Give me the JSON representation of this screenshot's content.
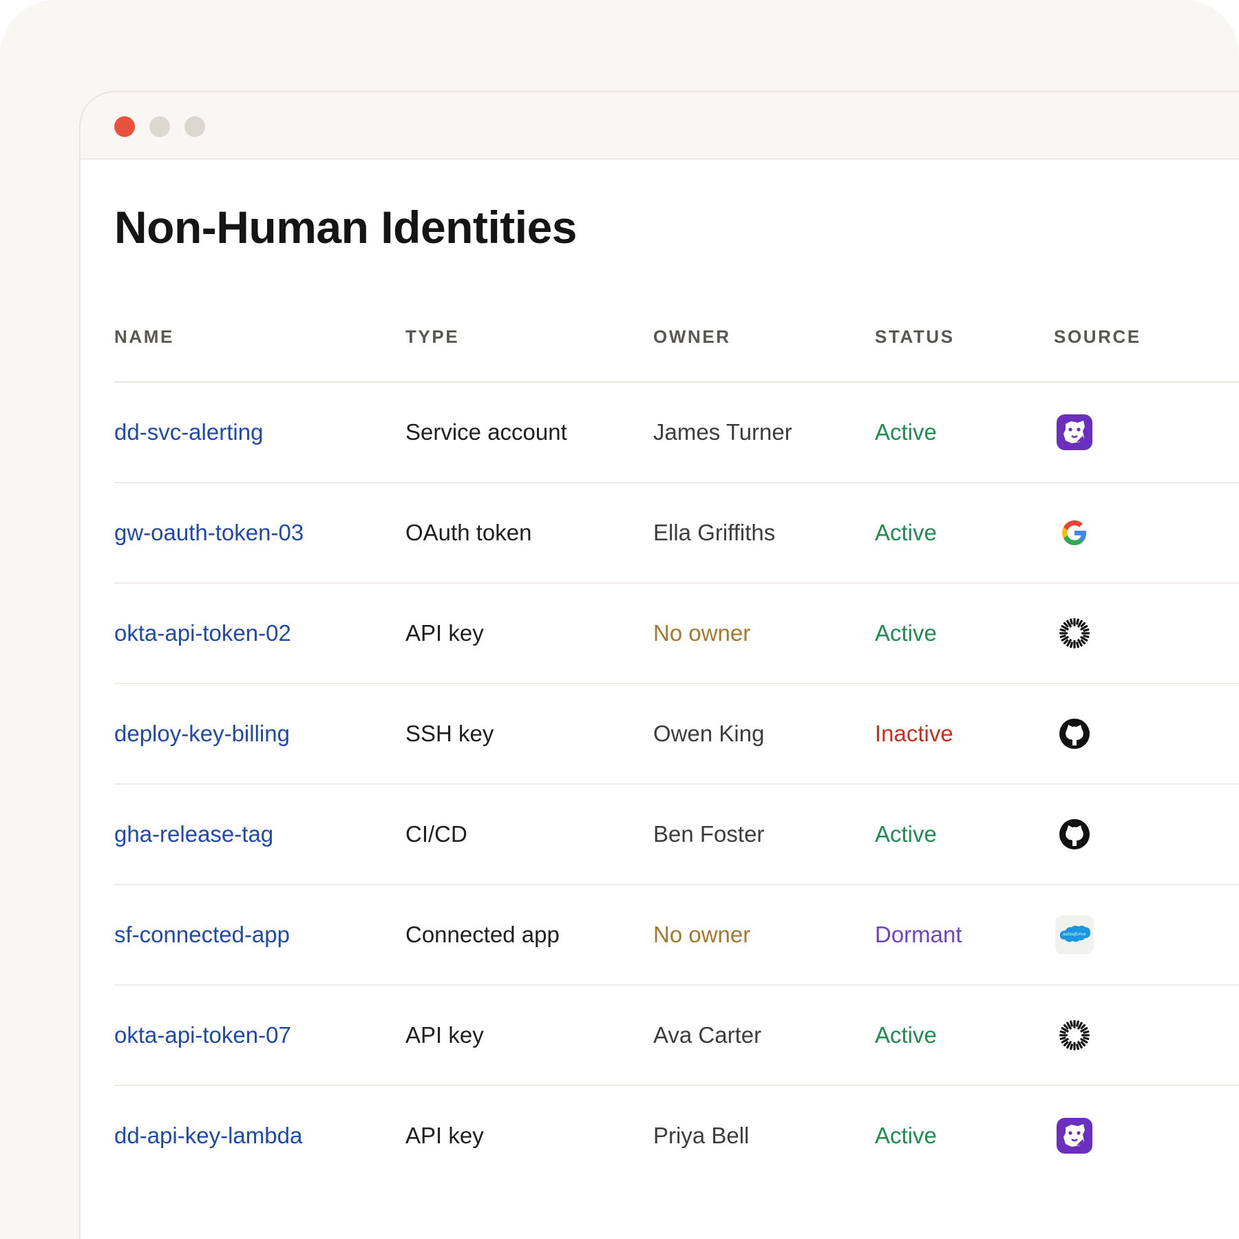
{
  "window": {
    "controls": [
      "close",
      "minimize",
      "maximize"
    ]
  },
  "page": {
    "title": "Non-Human Identities"
  },
  "table": {
    "headers": [
      "NAME",
      "TYPE",
      "OWNER",
      "STATUS",
      "SOURCE"
    ],
    "rows": [
      {
        "name": "dd-svc-alerting",
        "type": "Service account",
        "owner": "James Turner",
        "owner_state": "assigned",
        "status": "Active",
        "source": "datadog-icon"
      },
      {
        "name": "gw-oauth-token-03",
        "type": "OAuth token",
        "owner": "Ella Griffiths",
        "owner_state": "assigned",
        "status": "Active",
        "source": "google-icon"
      },
      {
        "name": "okta-api-token-02",
        "type": "API key",
        "owner": "No owner",
        "owner_state": "none",
        "status": "Active",
        "source": "okta-icon"
      },
      {
        "name": "deploy-key-billing",
        "type": "SSH key",
        "owner": "Owen King",
        "owner_state": "assigned",
        "status": "Inactive",
        "source": "github-icon"
      },
      {
        "name": "gha-release-tag",
        "type": "CI/CD",
        "owner": "Ben Foster",
        "owner_state": "assigned",
        "status": "Active",
        "source": "github-icon"
      },
      {
        "name": "sf-connected-app",
        "type": "Connected app",
        "owner": "No owner",
        "owner_state": "none",
        "status": "Dormant",
        "source": "salesforce-icon"
      },
      {
        "name": "okta-api-token-07",
        "type": "API key",
        "owner": "Ava Carter",
        "owner_state": "assigned",
        "status": "Active",
        "source": "okta-icon"
      },
      {
        "name": "dd-api-key-lambda",
        "type": "API key",
        "owner": "Priya Bell",
        "owner_state": "assigned",
        "status": "Active",
        "source": "datadog-icon"
      }
    ]
  },
  "colors": {
    "link": "#1f4aa8",
    "active": "#1e8d52",
    "inactive": "#c8301c",
    "dormant": "#6b45c4",
    "no_owner": "#a4782e",
    "close_dot": "#e8523a"
  }
}
